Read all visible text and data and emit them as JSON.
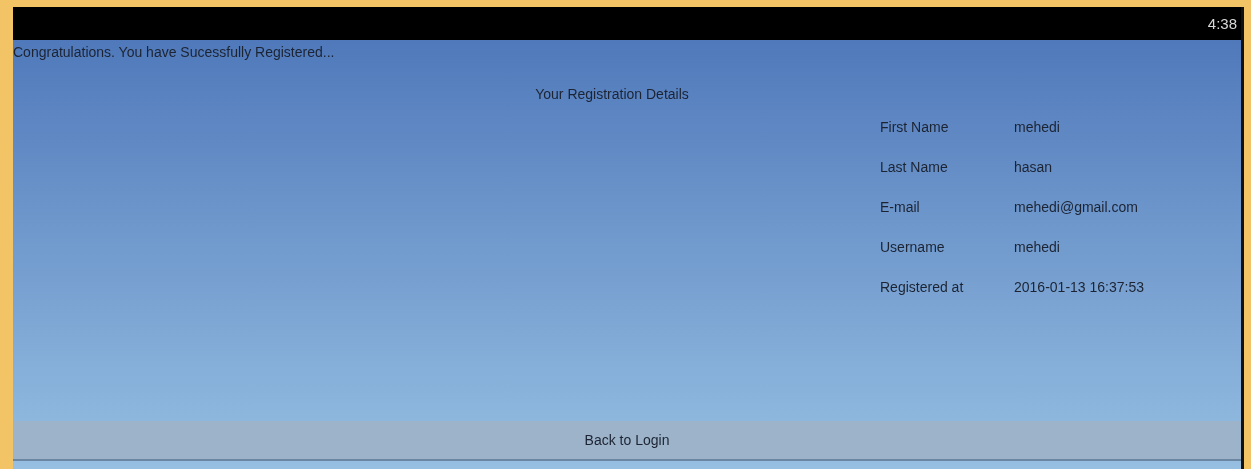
{
  "status_bar": {
    "time": "4:38"
  },
  "message": "Congratulations. You have Sucessfully Registered...",
  "details": {
    "title": "Your Registration Details",
    "rows": [
      {
        "label": "First Name",
        "value": "mehedi"
      },
      {
        "label": "Last Name",
        "value": "hasan"
      },
      {
        "label": "E-mail",
        "value": "mehedi@gmail.com"
      },
      {
        "label": "Username",
        "value": "mehedi"
      },
      {
        "label": "Registered at",
        "value": "2016-01-13 16:37:53"
      }
    ]
  },
  "button": {
    "label": "Back to Login"
  }
}
